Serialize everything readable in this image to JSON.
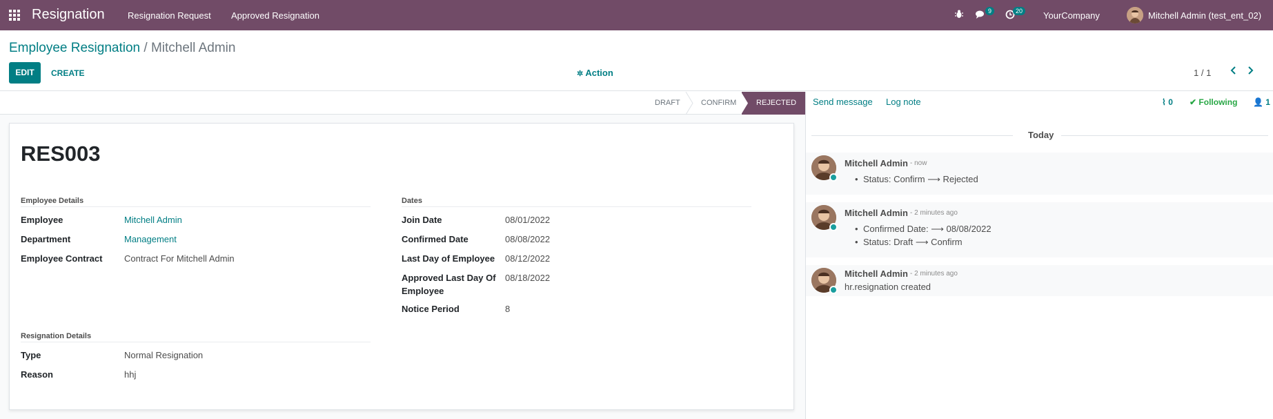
{
  "navbar": {
    "app_title": "Resignation",
    "menu": [
      "Resignation Request",
      "Approved Resignation"
    ],
    "messages_count": "9",
    "activities_count": "20",
    "company": "YourCompany",
    "user": "Mitchell Admin (test_ent_02)"
  },
  "breadcrumb": {
    "parent": "Employee Resignation",
    "separator": "/",
    "current": "Mitchell Admin"
  },
  "buttons": {
    "edit": "EDIT",
    "create": "CREATE",
    "action": "Action"
  },
  "pager": {
    "value": "1 / 1"
  },
  "statusbar": {
    "stages": [
      "DRAFT",
      "CONFIRM",
      "REJECTED"
    ],
    "active": "REJECTED"
  },
  "record": {
    "reference": "RES003",
    "employee_details": {
      "title": "Employee Details",
      "fields": [
        {
          "label": "Employee",
          "value": "Mitchell Admin"
        },
        {
          "label": "Department",
          "value": "Management"
        },
        {
          "label": "Employee Contract",
          "value": "Contract For Mitchell Admin"
        }
      ]
    },
    "dates": {
      "title": "Dates",
      "fields": [
        {
          "label": "Join Date",
          "value": "08/01/2022"
        },
        {
          "label": "Confirmed Date",
          "value": "08/08/2022"
        },
        {
          "label": "Last Day of Employee",
          "value": "08/12/2022"
        },
        {
          "label": "Approved Last Day Of Employee",
          "value": "08/18/2022"
        },
        {
          "label": "Notice Period",
          "value": "8"
        }
      ]
    },
    "resignation_details": {
      "title": "Resignation Details",
      "fields": [
        {
          "label": "Type",
          "value": "Normal Resignation"
        },
        {
          "label": "Reason",
          "value": "hhj"
        }
      ]
    }
  },
  "chatter": {
    "send_message": "Send message",
    "log_note": "Log note",
    "attachments": "0",
    "following": "Following",
    "followers": "1",
    "date_separator": "Today",
    "messages": [
      {
        "author": "Mitchell Admin",
        "time": "- now",
        "lines": [
          "Status: Confirm ⟶ Rejected"
        ]
      },
      {
        "author": "Mitchell Admin",
        "time": "- 2 minutes ago",
        "lines": [
          "Confirmed Date: ⟶ 08/08/2022",
          "Status: Draft ⟶ Confirm"
        ]
      },
      {
        "author": "Mitchell Admin",
        "time": "- 2 minutes ago",
        "body": "hr.resignation created"
      }
    ]
  },
  "colors": {
    "navbar": "#714b67",
    "accent": "#017e84",
    "active_stage": "#714b67",
    "online": "#28a745"
  }
}
